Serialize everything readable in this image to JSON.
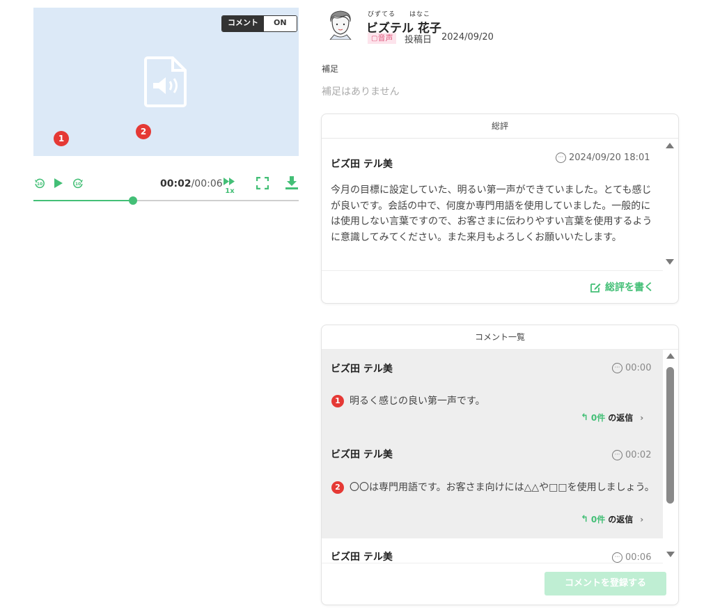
{
  "player": {
    "comment_toggle_label": "コメント",
    "comment_toggle_value": "ON",
    "markers": [
      "1",
      "2"
    ],
    "current_time": "00:02",
    "duration": "/00:06",
    "speed": "1x",
    "progress": 0.375
  },
  "profile": {
    "ruby_family": "びずてる",
    "ruby_given": "はなこ",
    "name": "ビズテル 花子",
    "media_badge": "音声",
    "post_date_label": "投稿日",
    "post_date": "2024/09/20"
  },
  "supplement": {
    "label": "補足",
    "text": "補足はありません"
  },
  "review": {
    "title": "総評",
    "author": "ビズ田 テル美",
    "timestamp": "2024/09/20 18:01",
    "body": "今月の目標に設定していた、明るい第一声ができていました。とても感じが良いです。会話の中で、何度か専門用語を使用していました。一般的には使用しない言葉ですので、お客さまに伝わりやすい言葉を使用するように意識してみてください。また来月もよろしくお願いいたします。",
    "write_label": "総評を書く"
  },
  "comments": {
    "title": "コメント一覧",
    "items": [
      {
        "author": "ビズ田 テル美",
        "time": "00:00",
        "marker": "1",
        "text": "明るく感じの良い第一声です。",
        "reply_count": "0件",
        "reply_label": "の返信"
      },
      {
        "author": "ビズ田 テル美",
        "time": "00:02",
        "marker": "2",
        "text": "〇〇は専門用語です。お客さま向けには△△や□□を使用しましょう。",
        "reply_count": "0件",
        "reply_label": "の返信"
      },
      {
        "author": "ビズ田 テル美",
        "time": "00:06"
      }
    ],
    "register_label": "コメントを登録する"
  },
  "colors": {
    "accent": "#43bf76",
    "marker": "#e53935",
    "media_bg": "#dce9f7"
  },
  "icons": [
    "rewind-10-icon",
    "play-icon",
    "forward-10-icon",
    "speed-icon",
    "fullscreen-icon",
    "download-icon",
    "audio-file-icon",
    "edit-icon",
    "reply-icon",
    "chevron-right-icon"
  ]
}
